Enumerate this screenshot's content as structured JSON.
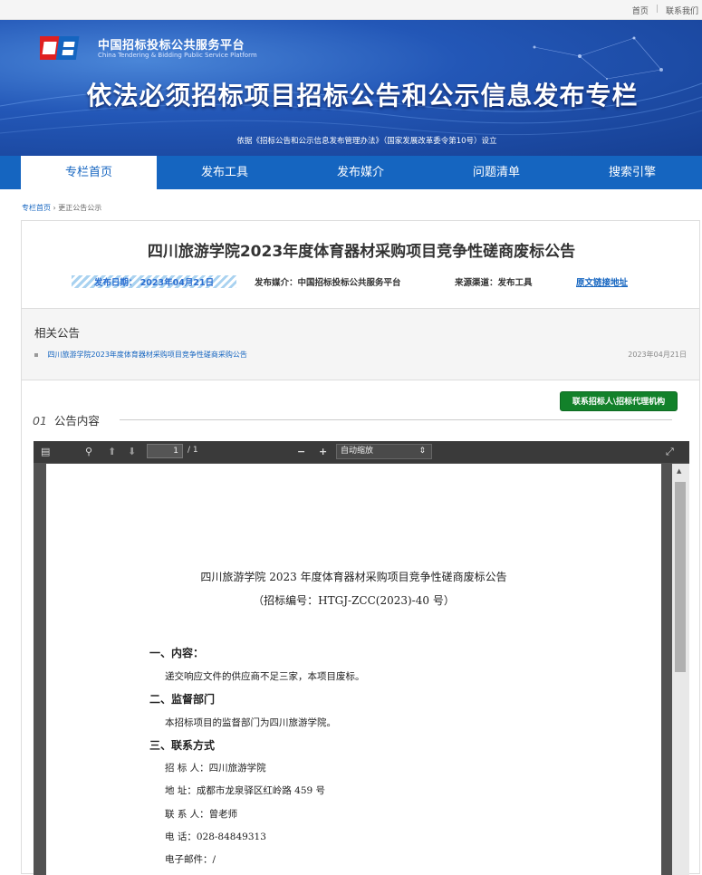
{
  "topbar": {
    "home": "首页",
    "contact": "联系我们"
  },
  "header": {
    "logo_cn": "中国招标投标公共服务平台",
    "logo_en": "China Tendering & Bidding Public Service Platform",
    "title": "依法必须招标项目招标公告和公示信息发布专栏",
    "subtitle": "依据《招标公告和公示信息发布管理办法》（国家发展改革委令第10号）设立"
  },
  "nav": {
    "items": [
      "专栏首页",
      "发布工具",
      "发布媒介",
      "问题清单",
      "搜索引擎"
    ]
  },
  "breadcrumb": {
    "home": "专栏首页",
    "separator": "›",
    "current": "更正公告公示"
  },
  "notice": {
    "title": "四川旅游学院2023年度体育器材采购项目竞争性磋商废标公告",
    "publish_date": "发布日期：  2023年04月21日",
    "media": "发布媒介：中国招标投标公共服务平台",
    "source": "来源渠道：发布工具",
    "original_link": "原文链接地址"
  },
  "related": {
    "heading": "相关公告",
    "items": [
      {
        "title": "四川旅游学院2023年度体育器材采购项目竞争性磋商采购公告",
        "date": "2023年04月21日"
      }
    ]
  },
  "contact_button": "联系招标人\\招标代理机构",
  "content_section": {
    "number": "01",
    "label": "公告内容"
  },
  "pdf_viewer": {
    "page_current": "1",
    "page_total": "/ 1",
    "zoom": "自动缩放",
    "document": {
      "title": "四川旅游学院 2023 年度体育器材采购项目竞争性磋商废标公告",
      "code": "（招标编号：HTGJ-ZCC(2023)-40 号）",
      "section1_heading": "一、内容：",
      "section1_text": "递交响应文件的供应商不足三家，本项目废标。",
      "section2_heading": "二、监督部门",
      "section2_text": "本招标项目的监督部门为四川旅游学院。",
      "section3_heading": "三、联系方式",
      "tenderer": "招  标  人：四川旅游学院",
      "address": "地      址：成都市龙泉驿区红岭路 459 号",
      "contact_person": "联  系  人：曾老师",
      "phone": "电      话：028-84849313",
      "email": "电子邮件：/"
    }
  }
}
